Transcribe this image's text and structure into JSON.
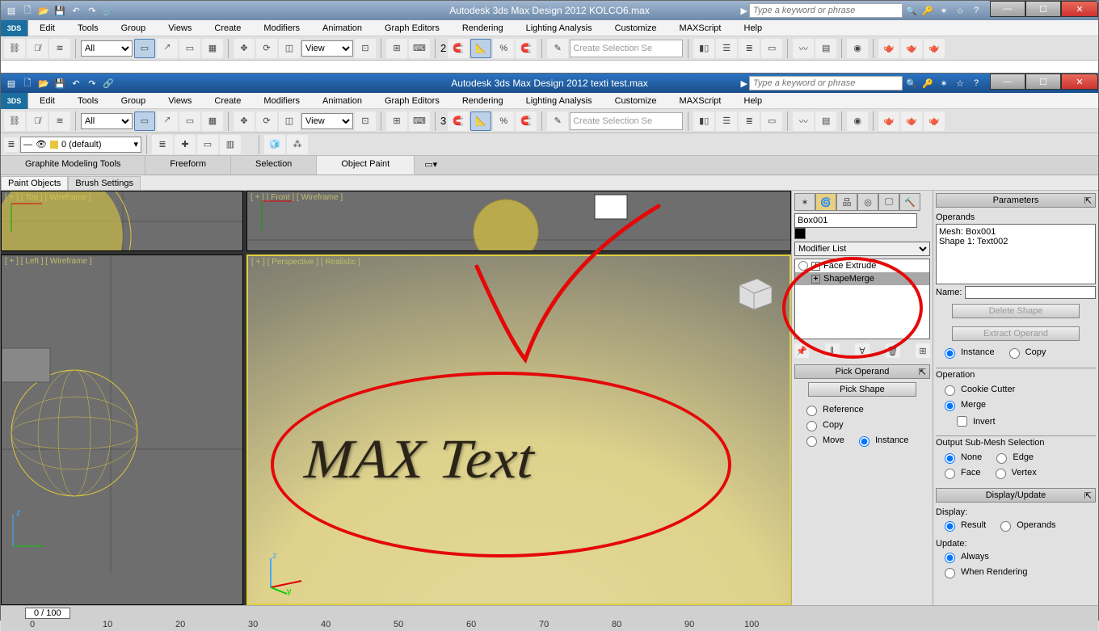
{
  "app_bg": {
    "title": "Autodesk 3ds Max Design 2012   KOLCO6.max",
    "search_ph": "Type a keyword or phrase"
  },
  "app_fg": {
    "title": "Autodesk 3ds Max Design 2012   texti test.max",
    "search_ph": "Type a keyword or phrase"
  },
  "menu": [
    "Edit",
    "Tools",
    "Group",
    "Views",
    "Create",
    "Modifiers",
    "Animation",
    "Graph Editors",
    "Rendering",
    "Lighting Analysis",
    "Customize",
    "MAXScript",
    "Help"
  ],
  "toolrow": {
    "all": "All",
    "view": "View",
    "named": "Create Selection Se",
    "num_bg": "2",
    "num_fg": "3"
  },
  "layer": "0 (default)",
  "ribbon": [
    "Graphite Modeling Tools",
    "Freeform",
    "Selection",
    "Object Paint"
  ],
  "subtabs": [
    "Paint Objects",
    "Brush Settings"
  ],
  "viewports": {
    "top": "[ + ] [ Top ] [ Wireframe ]",
    "front": "[ + ] [ Front ] [ Wireframe ]",
    "left": "[ + ] [ Left ] [ Wireframe ]",
    "persp": "[ + ] [ Perspective ] [ Realistic ]",
    "persp_text": "MAX Text"
  },
  "cmd": {
    "objname": "Box001",
    "modlist": "Modifier List",
    "stack": [
      {
        "name": "Face Extrude",
        "sel": false
      },
      {
        "name": "ShapeMerge",
        "sel": true
      }
    ],
    "pick_head": "Pick Operand",
    "pick_btn": "Pick Shape",
    "ref": "Reference",
    "copy": "Copy",
    "move": "Move",
    "inst": "Instance"
  },
  "params": {
    "head": "Parameters",
    "operands": "Operands",
    "op_mesh": "Mesh: Box001",
    "op_shape": "Shape 1: Text002",
    "name": "Name:",
    "del": "Delete Shape",
    "ext": "Extract Operand",
    "instance": "Instance",
    "copy": "Copy",
    "operation": "Operation",
    "cookie": "Cookie Cutter",
    "merge": "Merge",
    "invert": "Invert",
    "outsub": "Output Sub-Mesh Selection",
    "none": "None",
    "edge": "Edge",
    "face": "Face",
    "vertex": "Vertex",
    "disp_head": "Display/Update",
    "display": "Display:",
    "result": "Result",
    "operands2": "Operands",
    "update": "Update:",
    "always": "Always",
    "when": "When Rendering"
  },
  "timeline": {
    "thumb": "0 / 100",
    "ticks": [
      "0",
      "10",
      "20",
      "30",
      "40",
      "50",
      "60",
      "70",
      "80",
      "90",
      "100"
    ]
  }
}
